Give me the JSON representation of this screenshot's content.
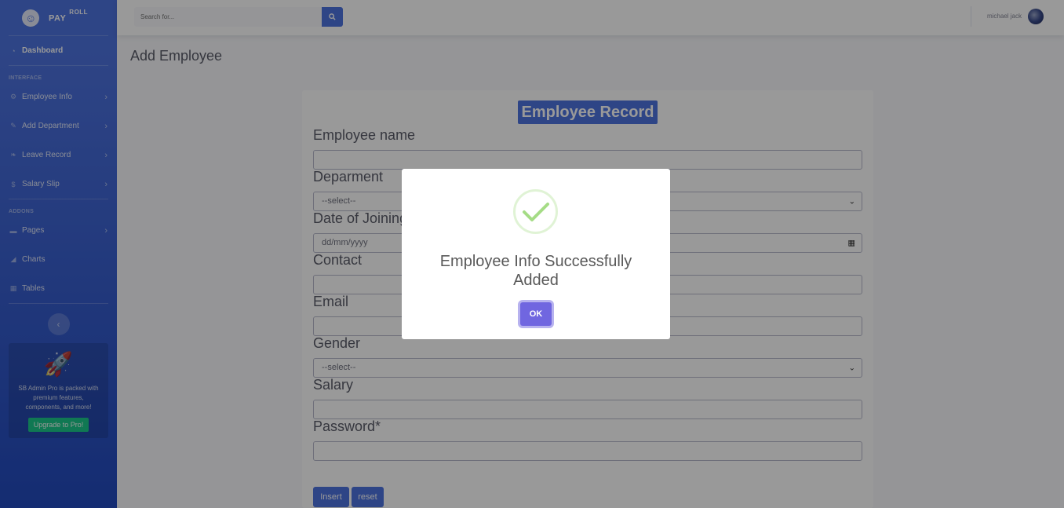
{
  "brand": {
    "name": "PAY",
    "sup": "ROLL",
    "icon": "laugh-wink-icon"
  },
  "sidebar": {
    "dashboard": "Dashboard",
    "heading_interface": "INTERFACE",
    "items_interface": [
      {
        "label": "Employee Info",
        "icon": "cog-icon"
      },
      {
        "label": "Add Department",
        "icon": "wrench-icon"
      },
      {
        "label": "Leave Record",
        "icon": "leaf-icon"
      },
      {
        "label": "Salary Slip",
        "icon": "dollar-icon"
      }
    ],
    "heading_addons": "ADDONS",
    "items_addons": [
      {
        "label": "Pages",
        "icon": "folder-icon"
      },
      {
        "label": "Charts",
        "icon": "chart-area-icon"
      },
      {
        "label": "Tables",
        "icon": "table-icon"
      }
    ],
    "promo_text": "SB Admin Pro is packed with premium features, components, and more!",
    "promo_button": "Upgrade to Pro!"
  },
  "topbar": {
    "search_placeholder": "Search for...",
    "username": "michael jack"
  },
  "page": {
    "title": "Add Employee"
  },
  "form": {
    "header": "Employee Record",
    "labels": {
      "name": "Employee name",
      "department": "Deparment",
      "date": "Date of Joining",
      "contact": "Contact",
      "email": "Email",
      "gender": "Gender",
      "salary": "Salary",
      "password": "Password*"
    },
    "department_value": "--select--",
    "date_placeholder": "dd/mm/yyyy",
    "gender_value": "--select--",
    "insert_button": "Insert",
    "reset_button": "reset"
  },
  "modal": {
    "title": "Employee Info Successfully Added",
    "ok_button": "OK",
    "icon": "success-check-icon",
    "accent": "#7066e0"
  },
  "colors": {
    "primary": "#4e73df",
    "success": "#1cc88a"
  }
}
